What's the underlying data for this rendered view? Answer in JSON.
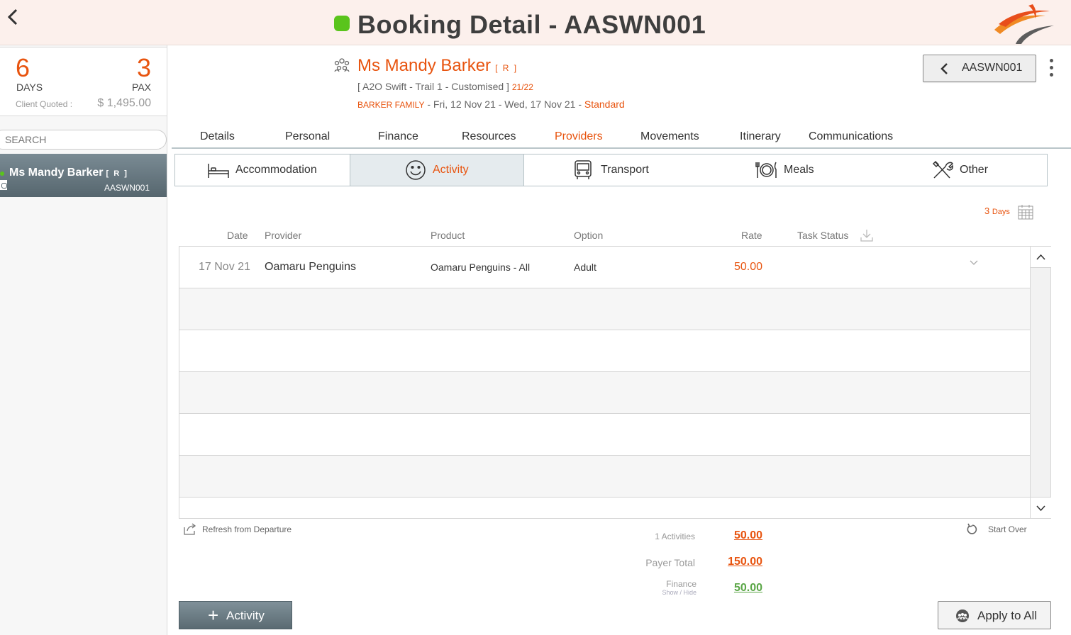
{
  "header": {
    "title": "Booking Detail - AASWN001",
    "status_color": "#5ac41c"
  },
  "summary": {
    "days_value": "6",
    "days_label": "DAYS",
    "pax_value": "3",
    "pax_label": "PAX",
    "client_quoted_label": "Client Quoted :",
    "client_quoted_value": "$ 1,495.00"
  },
  "sidebar": {
    "search_placeholder": "SEARCH",
    "passenger": {
      "name": "Ms Mandy Barker",
      "ref": "[ R ]",
      "code": "AASWN001"
    }
  },
  "customer": {
    "name": "Ms Mandy Barker",
    "ref": "[ R ]",
    "trip": "[ A2O Swift - Trail 1 - Customised ]",
    "season": "21/22",
    "family": "BARKER FAMILY",
    "dates": " - Fri, 12 Nov 21 - Wed, 17 Nov 21 - ",
    "level": "Standard"
  },
  "booking_nav": {
    "label": "AASWN001"
  },
  "tabs": [
    {
      "label": "Details"
    },
    {
      "label": "Personal"
    },
    {
      "label": "Finance"
    },
    {
      "label": "Resources"
    },
    {
      "label": "Providers",
      "active": true
    },
    {
      "label": "Movements"
    },
    {
      "label": "Itinerary"
    },
    {
      "label": "Communications"
    }
  ],
  "subtabs": [
    {
      "label": "Accommodation",
      "icon": "bed-icon"
    },
    {
      "label": "Activity",
      "icon": "smiley-icon",
      "active": true
    },
    {
      "label": "Transport",
      "icon": "bus-icon"
    },
    {
      "label": "Meals",
      "icon": "plate-cutlery-icon"
    },
    {
      "label": "Other",
      "icon": "tools-icon"
    }
  ],
  "days_indicator": {
    "number": "3",
    "label": "Days"
  },
  "table": {
    "headers": [
      "Date",
      "Provider",
      "Product",
      "Option",
      "Rate",
      "Task Status"
    ],
    "rows": [
      {
        "date": "17 Nov 21",
        "provider": "Oamaru Penguins",
        "product": "Oamaru Penguins - All",
        "option": "Adult",
        "rate": "50.00"
      }
    ]
  },
  "footer": {
    "refresh_label": "Refresh from Departure",
    "start_over_label": "Start Over",
    "activities_label": "1 Activities",
    "activities_value": "50.00",
    "payer_total_label": "Payer Total",
    "payer_total_value": "150.00",
    "finance_label": "Finance",
    "finance_sub": "Show / Hide",
    "finance_value": "50.00",
    "add_button_label": "Activity",
    "apply_all_label": "Apply to All"
  },
  "colors": {
    "accent": "#e8540f",
    "finance_green": "#5aa646",
    "header_bg": "#fcf0ec"
  }
}
